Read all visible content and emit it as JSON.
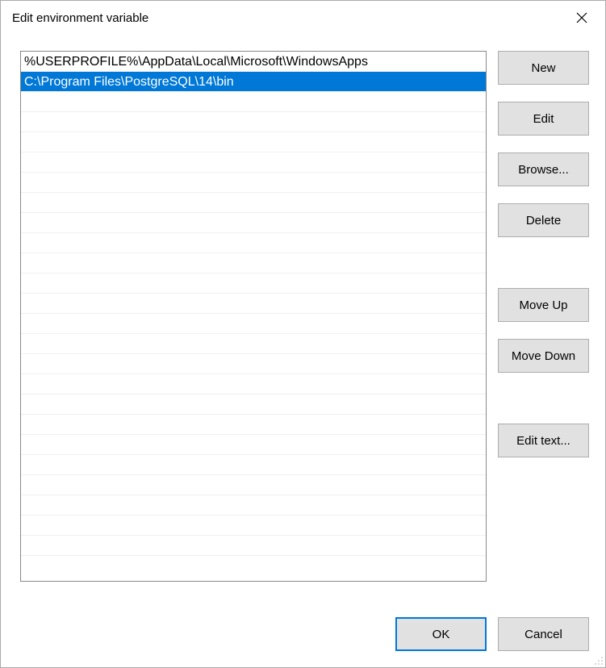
{
  "window": {
    "title": "Edit environment variable"
  },
  "list": {
    "items": [
      {
        "text": "%USERPROFILE%\\AppData\\Local\\Microsoft\\WindowsApps",
        "selected": false
      },
      {
        "text": "C:\\Program Files\\PostgreSQL\\14\\bin",
        "selected": true
      }
    ],
    "empty_rows": 23
  },
  "buttons": {
    "new": "New",
    "edit": "Edit",
    "browse": "Browse...",
    "delete": "Delete",
    "move_up": "Move Up",
    "move_down": "Move Down",
    "edit_text": "Edit text..."
  },
  "footer": {
    "ok": "OK",
    "cancel": "Cancel"
  }
}
